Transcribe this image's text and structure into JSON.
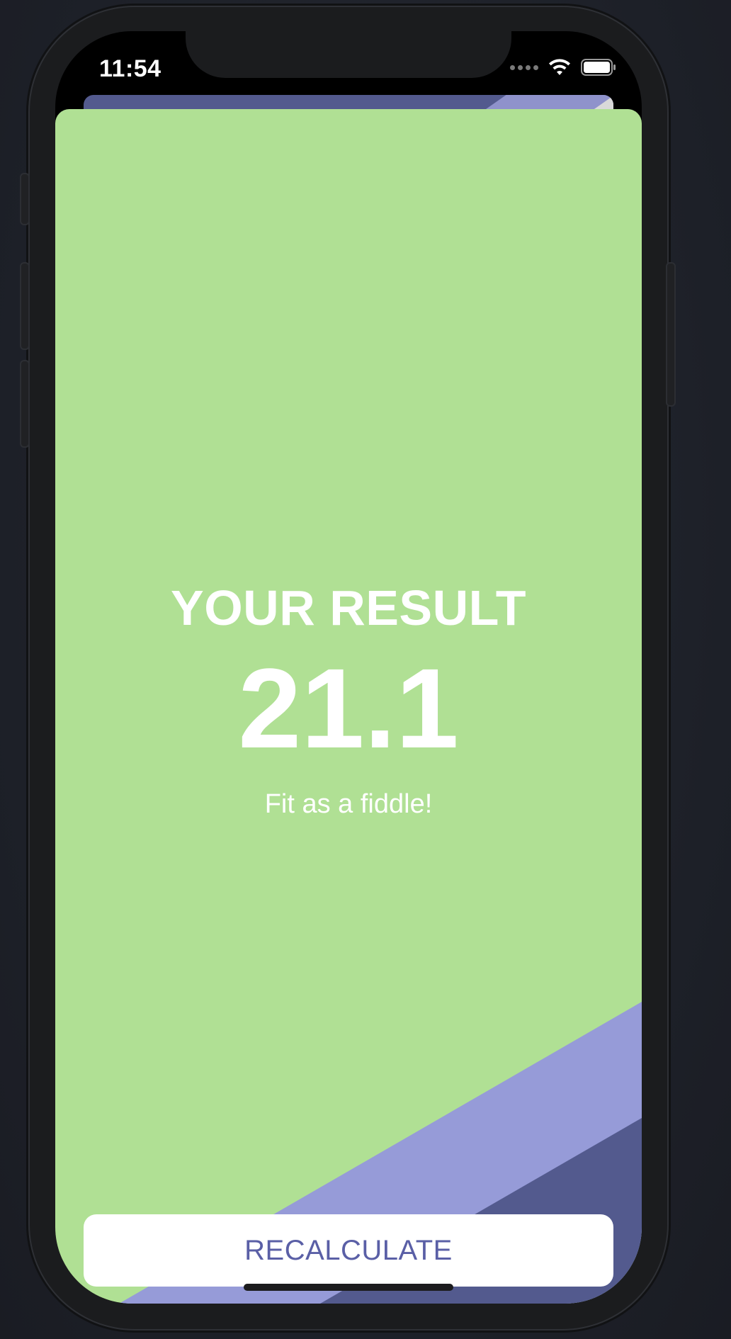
{
  "status_bar": {
    "time": "11:54",
    "icons": [
      "cellular-signal-icon",
      "wifi-icon",
      "battery-icon"
    ]
  },
  "result": {
    "title": "YOUR RESULT",
    "value": "21.1",
    "message": "Fit as a fiddle!"
  },
  "actions": {
    "recalculate_label": "RECALCULATE"
  },
  "colors": {
    "sheet_background": "#b0e094",
    "stripe_light": "#969bd8",
    "stripe_dark": "#535a8e",
    "button_text": "#5a5fa6",
    "text_primary": "#ffffff"
  }
}
